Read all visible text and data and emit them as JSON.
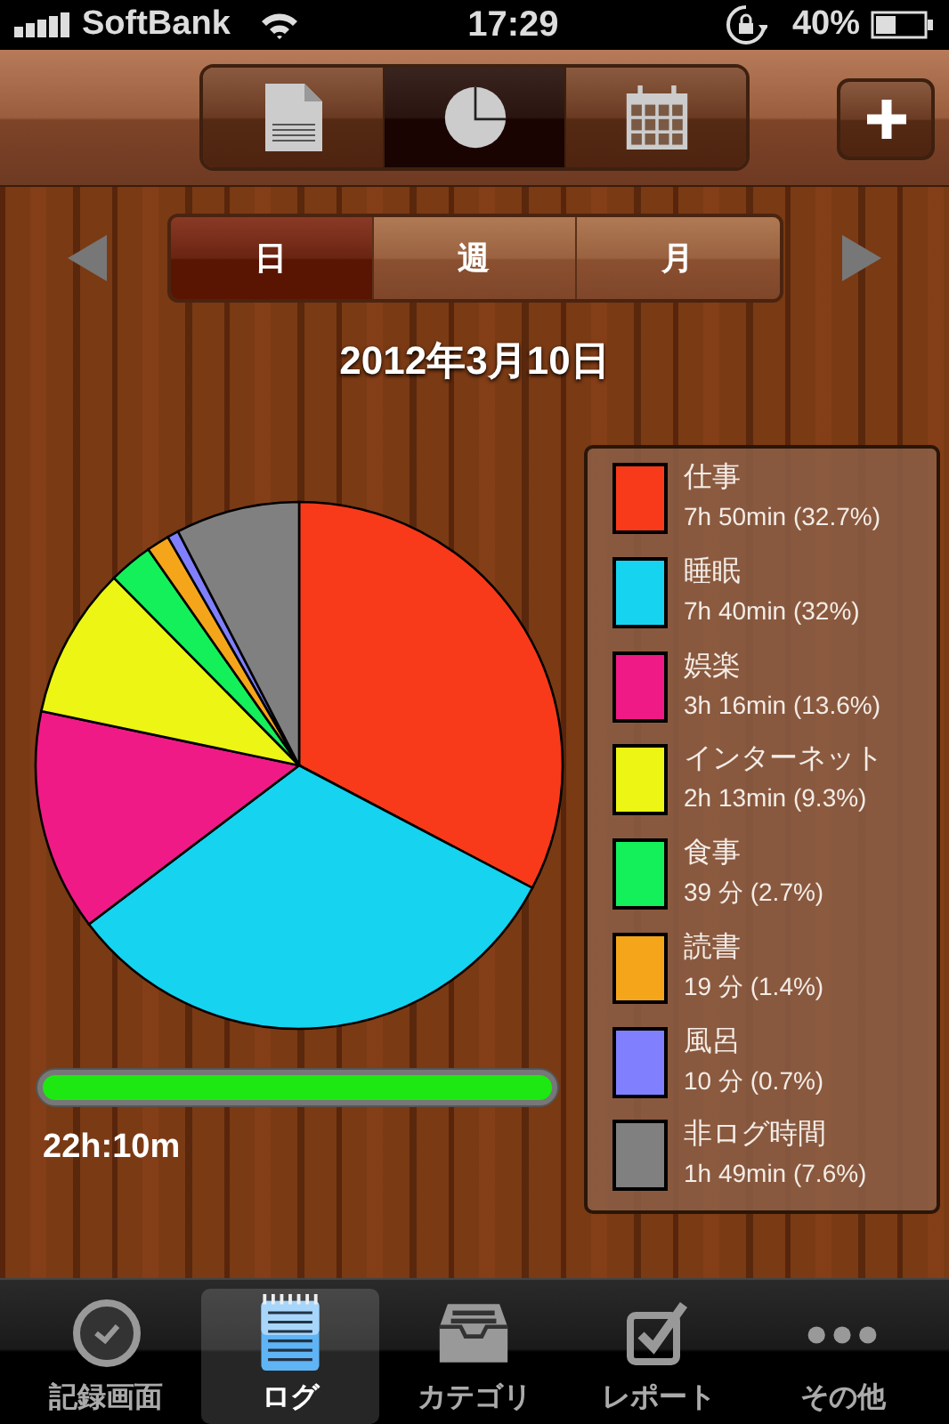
{
  "status_bar": {
    "carrier": "SoftBank",
    "time": "17:29",
    "battery": "40%"
  },
  "view_tabs": [
    {
      "kind": "document",
      "selected": false
    },
    {
      "kind": "pie",
      "selected": true
    },
    {
      "kind": "calendar",
      "selected": false
    }
  ],
  "period_tabs": [
    {
      "label": "日",
      "selected": true
    },
    {
      "label": "週",
      "selected": false
    },
    {
      "label": "月",
      "selected": false
    }
  ],
  "date": "2012年3月10日",
  "chart_data": {
    "type": "pie",
    "values": [
      32.7,
      32,
      13.6,
      9.3,
      2.7,
      1.4,
      0.7,
      7.6
    ]
  },
  "legend": [
    {
      "name": "仕事",
      "duration": "7h 50min (32.7%)",
      "color": "#f93a1a"
    },
    {
      "name": "睡眠",
      "duration": "7h 40min (32%)",
      "color": "#16d3f0"
    },
    {
      "name": "娯楽",
      "duration": "3h 16min (13.6%)",
      "color": "#f01a86"
    },
    {
      "name": "インターネット",
      "duration": "2h 13min (9.3%)",
      "color": "#ecf514"
    },
    {
      "name": "食事",
      "duration": "39 分 (2.7%)",
      "color": "#14f05a"
    },
    {
      "name": "読書",
      "duration": "19 分 (1.4%)",
      "color": "#f5a51a"
    },
    {
      "name": "風呂",
      "duration": "10 分 (0.7%)",
      "color": "#8080ff"
    },
    {
      "name": "非ログ時間",
      "duration": "1h 49min (7.6%)",
      "color": "#808080"
    }
  ],
  "progress": {
    "level": 1,
    "total": "22h:10m"
  },
  "tab_bar": [
    {
      "label": "記録画面",
      "kind": "clock",
      "selected": false
    },
    {
      "label": "ログ",
      "kind": "notepad",
      "selected": true
    },
    {
      "label": "カテゴリ",
      "kind": "tray",
      "selected": false
    },
    {
      "label": "レポート",
      "kind": "checkbox",
      "selected": false
    },
    {
      "label": "その他",
      "kind": "more",
      "selected": false
    }
  ]
}
